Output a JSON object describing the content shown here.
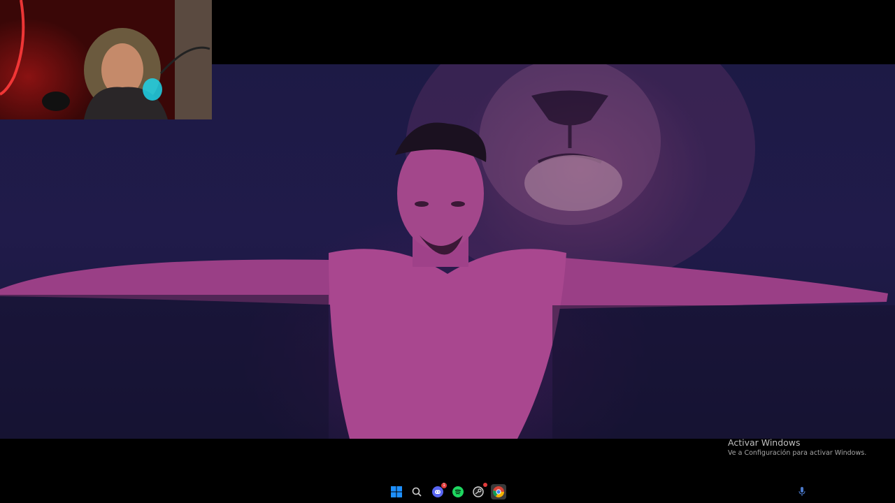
{
  "watermark": {
    "title": "Activar Windows",
    "subtitle": "Ve a Configuración para activar Windows."
  },
  "taskbar": {
    "items": [
      {
        "name": "start",
        "icon": "windows-start-icon"
      },
      {
        "name": "search",
        "icon": "search-icon"
      },
      {
        "name": "discord",
        "icon": "discord-icon",
        "badge": "1"
      },
      {
        "name": "spotify",
        "icon": "spotify-icon"
      },
      {
        "name": "steam",
        "icon": "steam-icon"
      },
      {
        "name": "chrome",
        "icon": "chrome-icon",
        "active": true
      }
    ],
    "tray": {
      "icon": "microphone-icon"
    }
  },
  "colors": {
    "background": "#000000",
    "video_tint": "#201b4a",
    "skin_tint": "#b04a8e",
    "windows_blue": "#1e90ff",
    "spotify_green": "#1ed760",
    "discord_blurple": "#5865f2"
  }
}
